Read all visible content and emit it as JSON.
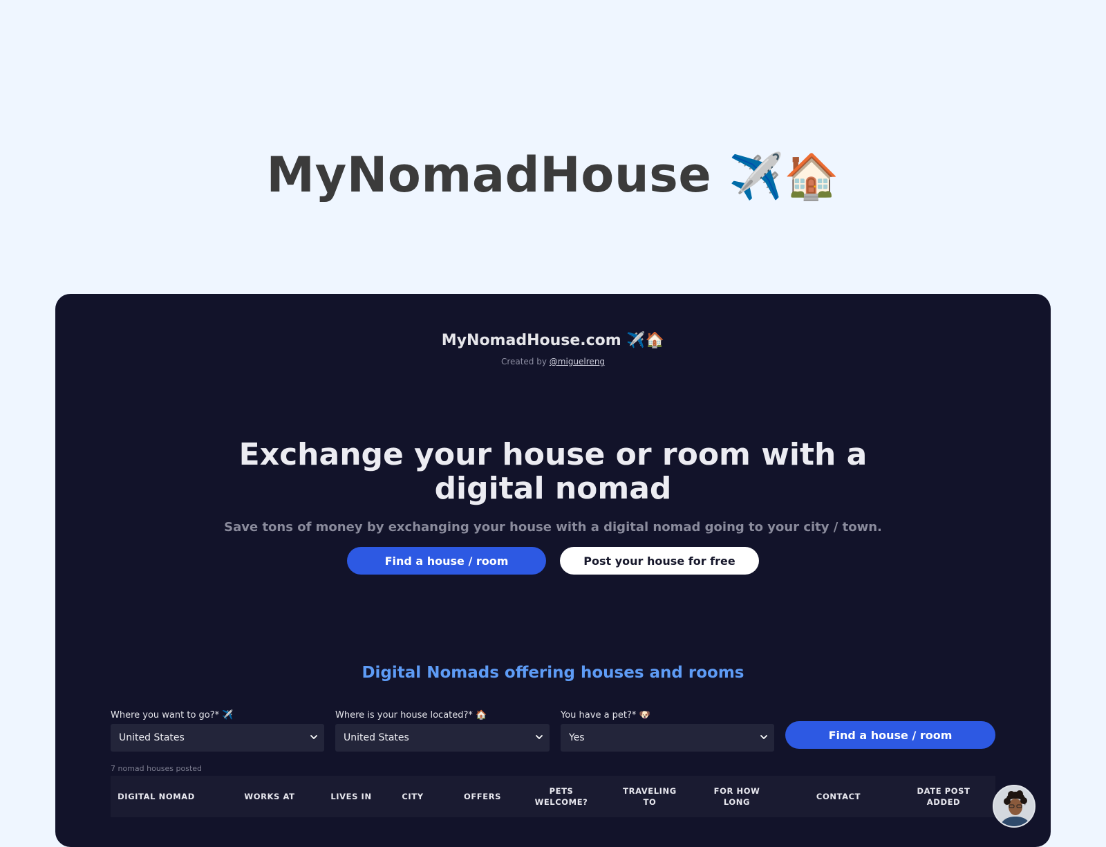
{
  "page": {
    "title": "MyNomadHouse",
    "title_emoji": "✈️🏠"
  },
  "app": {
    "brand": "MyNomadHouse.com",
    "brand_emoji": "✈️🏠",
    "credit_prefix": "Created by",
    "credit_handle": "@miguelreng",
    "headline": "Exchange your house or room with a digital nomad",
    "subtitle": "Save tons of money by exchanging your house with a digital nomad going to your city / town.",
    "cta_primary": "Find a house / room",
    "cta_secondary": "Post your house for free",
    "section_title": "Digital Nomads offering houses and rooms",
    "filters": {
      "destination": {
        "label": "Where you want to go?* ✈️",
        "value": "United States"
      },
      "location": {
        "label": "Where is your house located?* 🏠",
        "value": "United States"
      },
      "pet": {
        "label": "You have a pet?* 🐶",
        "value": "Yes"
      },
      "submit_label": "Find a house / room"
    },
    "count_text": "7 nomad houses posted",
    "table": {
      "columns": [
        "DIGITAL NOMAD",
        "WORKS AT",
        "LIVES IN",
        "CITY",
        "OFFERS",
        "PETS WELCOME?",
        "TRAVELING TO",
        "FOR HOW LONG",
        "CONTACT",
        "DATE POST ADDED"
      ]
    }
  },
  "colors": {
    "page_bg": "#eff6ff",
    "frame_bg": "#12132a",
    "accent_blue": "#2d59e3",
    "section_title": "#5e9cf6"
  },
  "icons": {
    "select_chevron": "chevron-down-icon",
    "avatar": "user-avatar"
  }
}
